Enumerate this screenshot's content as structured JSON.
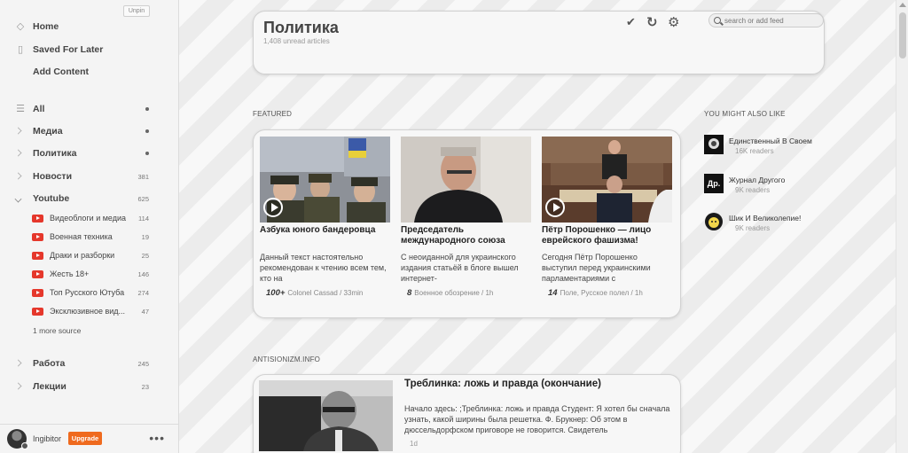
{
  "sidebar": {
    "unpin_label": "Unpin",
    "top_items": [
      {
        "label": "Home",
        "icon": "home-icon"
      },
      {
        "label": "Saved For Later",
        "icon": "bookmark-icon"
      },
      {
        "label": "Add Content",
        "icon": "plus-icon"
      }
    ],
    "feeds": {
      "all": {
        "label": "All"
      },
      "media": {
        "label": "Медиа"
      },
      "politics": {
        "label": "Политика"
      },
      "news": {
        "label": "Новости",
        "count": "381"
      },
      "youtube": {
        "label": "Youtube",
        "count": "625"
      },
      "work": {
        "label": "Работа",
        "count": "245"
      },
      "lectures": {
        "label": "Лекции",
        "count": "23"
      }
    },
    "youtube_items": [
      {
        "label": "Видеоблоги и медиа",
        "count": "114"
      },
      {
        "label": "Военная техника",
        "count": "19"
      },
      {
        "label": "Драки и разборки",
        "count": "25"
      },
      {
        "label": "Жесть 18+",
        "count": "146"
      },
      {
        "label": "Топ Русского Ютуба",
        "count": "274"
      },
      {
        "label": "Эксклюзивное вид...",
        "count": "47"
      }
    ],
    "more_source": "1 more source",
    "footer": {
      "username": "Ingibitor",
      "upgrade_label": "Upgrade",
      "more": "•••"
    }
  },
  "header": {
    "title": "Политика",
    "subtitle": "1,408 unread articles",
    "search_placeholder": "search or add feed",
    "actions": [
      {
        "icon": "checkmark-icon",
        "glyph": "✔"
      },
      {
        "icon": "refresh-icon",
        "glyph": "↻"
      },
      {
        "icon": "gear-icon",
        "glyph": "⚙"
      }
    ]
  },
  "featured": {
    "label": "FEATURED",
    "items": [
      {
        "title": "Азбука юного бандеровца",
        "summary": "Данный текст настоятельно рекомендован к чтению всем тем, кто на",
        "count": "100+",
        "source": "Colonel Cassad / 33min"
      },
      {
        "title": "Председатель международного союза",
        "summary": "С неоиданной для украинского издания статьёй в блоге вышел интернет-",
        "count": "8",
        "source": "Военное обозрение / 1h"
      },
      {
        "title": "Пётр Порошенко — лицо еврейского фашизма!",
        "summary": "Сегодня Пётр Порошенко выступил перед украинскими парламентариями с",
        "count": "14",
        "source": "Поле, Русское полел / 1h"
      }
    ]
  },
  "suggestions": {
    "label": "YOU MIGHT ALSO LIKE",
    "items": [
      {
        "name": "Единственный В Своем",
        "readers": "16K readers"
      },
      {
        "name": "Журнал Другого",
        "readers": "9K readers",
        "icon_text": "Др."
      },
      {
        "name": "Шик И Великолепие!",
        "readers": "9K readers"
      }
    ]
  },
  "source_section": {
    "label": "ANTISIONIZM.INFO",
    "article": {
      "title": "Треблинка: ложь и правда (окончание)",
      "summary": "Начало здесь: ;Треблинка: ложь и правда Студент: Я хотел бы сначала узнать, какой ширины была решетка. Ф. Брукнер: Об этом в дюссельдорфском приговоре не говорится. Свидетель",
      "meta": "1d"
    }
  }
}
